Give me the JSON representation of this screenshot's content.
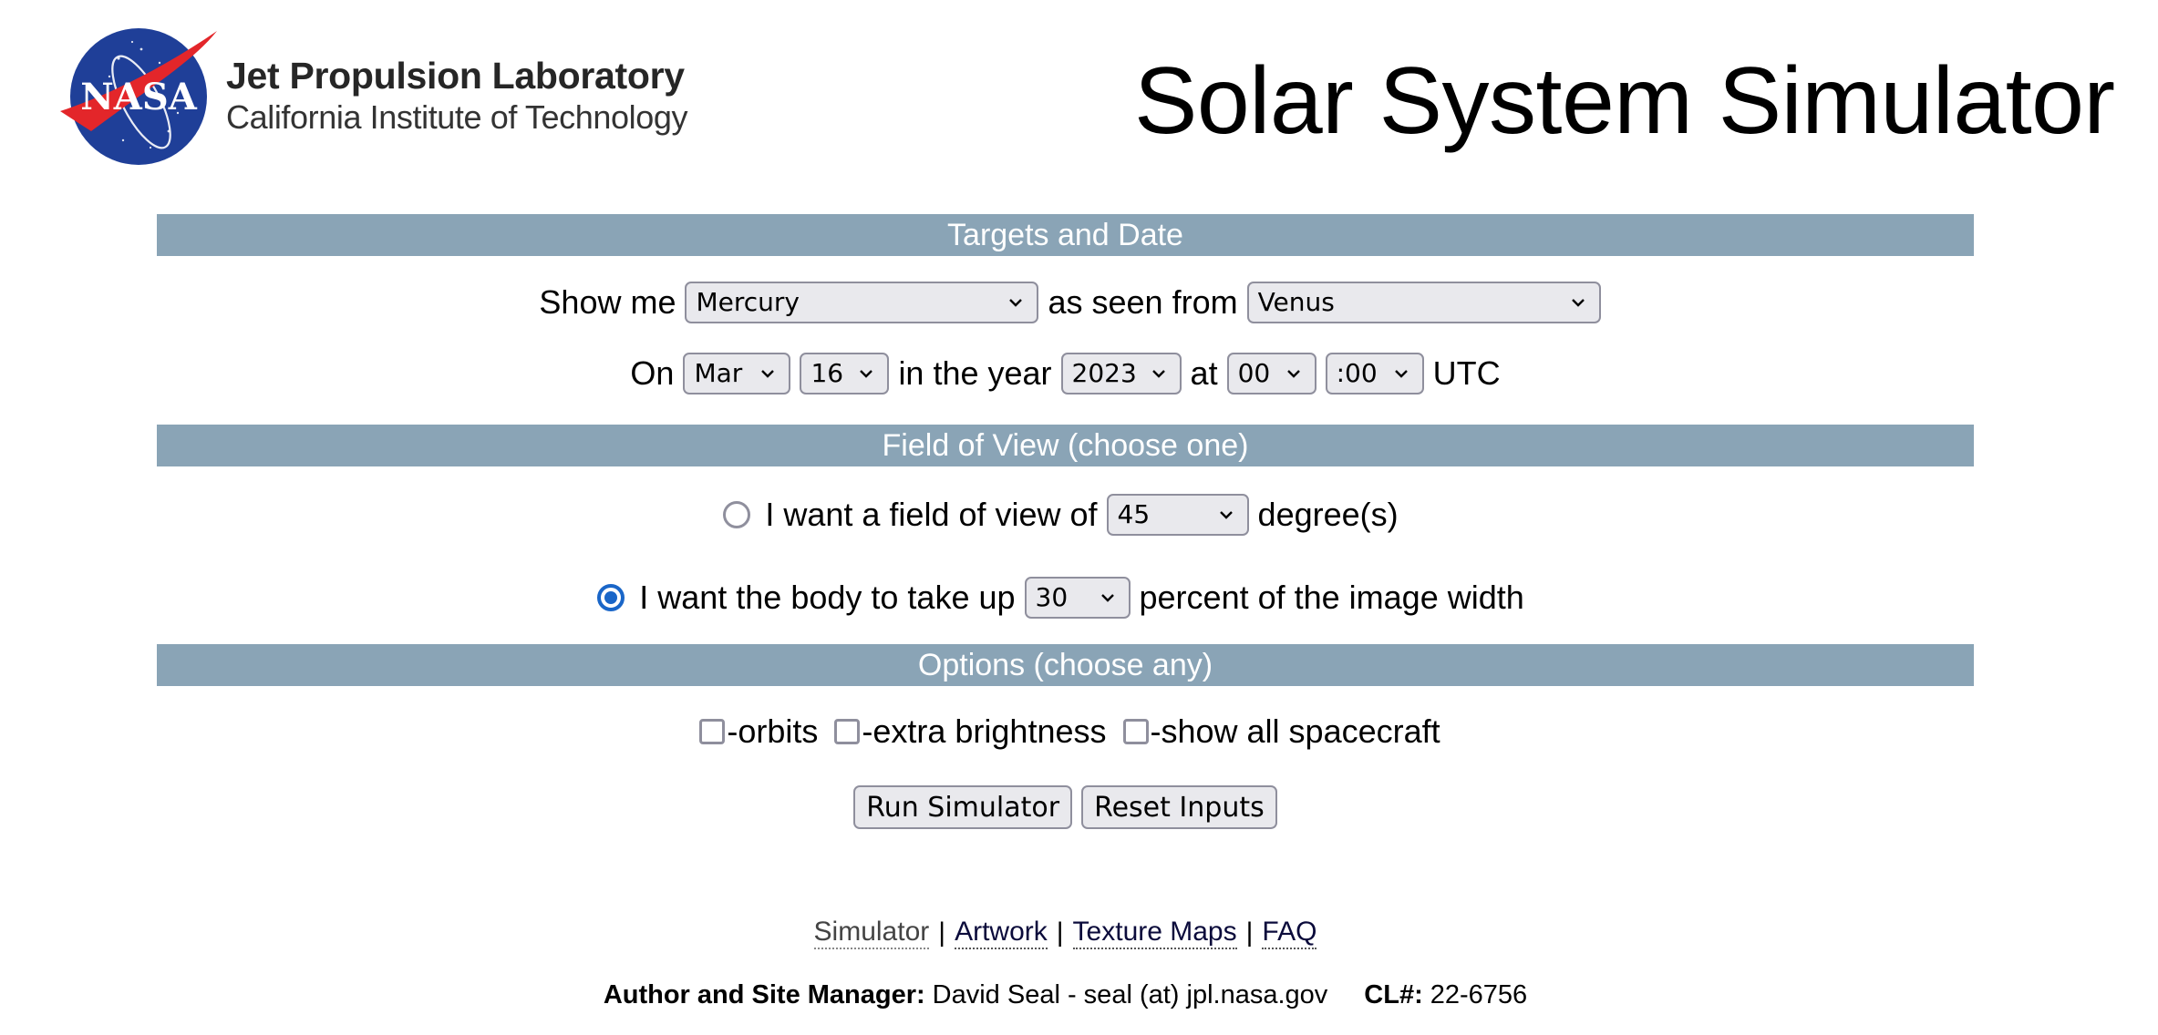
{
  "header": {
    "logo": {
      "emblem_text": "NASA",
      "line1": "Jet Propulsion Laboratory",
      "line2": "California Institute of Technology",
      "emblem_blue": "#1f3f98",
      "emblem_red": "#e3262a"
    },
    "title": "Solar System Simulator"
  },
  "colors": {
    "section_bar": "#8aa4b6",
    "radio_checked": "#1a66c8",
    "control_bg": "#e9e9ed",
    "control_border": "#8f8f9d"
  },
  "sections": {
    "targets": {
      "title": "Targets and Date",
      "show_me_label": "Show me",
      "target": {
        "value": "Mercury"
      },
      "seen_from_label": "as seen from",
      "observer": {
        "value": "Venus"
      },
      "on_label": "On",
      "month": {
        "value": "Mar"
      },
      "day": {
        "value": "16"
      },
      "year_label": "in the year",
      "year": {
        "value": "2023"
      },
      "at_label": "at",
      "hour": {
        "value": "00"
      },
      "minute": {
        "value": ":00"
      },
      "utc_label": "UTC"
    },
    "fov": {
      "title": "Field of View (choose one)",
      "option1": {
        "checked": false,
        "label": "I want a field of view of",
        "select_value": "45",
        "suffix": "degree(s)"
      },
      "option2": {
        "checked": true,
        "label": "I want the body to take up",
        "select_value": "30",
        "suffix": "percent of the image width"
      }
    },
    "options": {
      "title": "Options (choose any)",
      "checkboxes": [
        {
          "label": "-orbits",
          "checked": false
        },
        {
          "label": "-extra brightness",
          "checked": false
        },
        {
          "label": "-show all spacecraft",
          "checked": false
        }
      ]
    }
  },
  "buttons": {
    "run": "Run Simulator",
    "reset": "Reset Inputs"
  },
  "footer": {
    "links": [
      {
        "label": "Simulator",
        "current": true
      },
      {
        "label": "Artwork"
      },
      {
        "label": "Texture Maps"
      },
      {
        "label": "FAQ"
      }
    ],
    "separator": "|",
    "author_label": "Author and Site Manager:",
    "author_value": "David Seal - seal (at) jpl.nasa.gov",
    "cl_label": "CL#:",
    "cl_value": "22-6756"
  }
}
